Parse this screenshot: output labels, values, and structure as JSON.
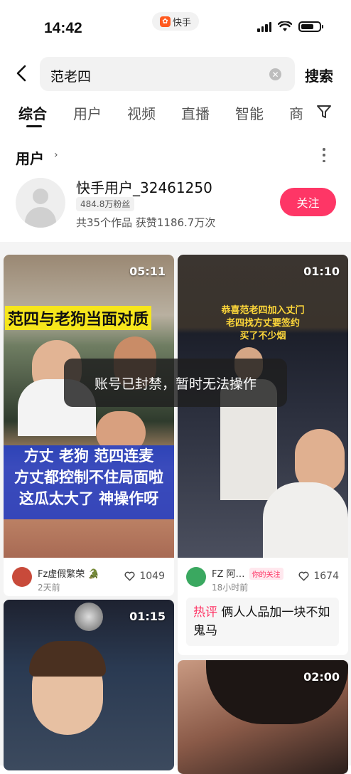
{
  "status_bar": {
    "time": "14:42",
    "app_pill": "快手"
  },
  "search": {
    "query": "范老四",
    "button": "搜索"
  },
  "tabs": [
    {
      "label": "综合",
      "active": true
    },
    {
      "label": "用户",
      "active": false
    },
    {
      "label": "视频",
      "active": false
    },
    {
      "label": "直播",
      "active": false
    },
    {
      "label": "智能",
      "active": false
    },
    {
      "label": "商",
      "active": false
    }
  ],
  "user_section": {
    "title": "用户",
    "user": {
      "name": "快手用户_32461250",
      "fans": "484.8万粉丝",
      "stats": "共35个作品 获赞1186.7万次",
      "follow_label": "关注"
    }
  },
  "videos": [
    {
      "duration": "05:11",
      "overlay_top": "范四与老狗当面对质",
      "overlay_lines": [
        "方丈 老狗 范四连麦",
        "方丈都控制不住局面啦",
        "这瓜太大了 神操作呀"
      ],
      "author": "Fz虚假繁荣",
      "time": "2天前",
      "likes": "1049"
    },
    {
      "duration": "01:10",
      "overlay_lines": [
        "恭喜范老四加入丈门",
        "老四找方丈要签约",
        "买了不少烟"
      ],
      "author": "FZ 阿…",
      "tag": "你的关注",
      "time": "18小时前",
      "likes": "1674",
      "comment_tag": "热评",
      "comment": "俩人人品加一块不如鬼马"
    },
    {
      "duration": "01:15"
    },
    {
      "duration": "02:00"
    }
  ],
  "toast": "账号已封禁，暂时无法操作",
  "colors": {
    "accent": "#fe3666",
    "yellow_banner": "#f6e61c",
    "blue_banner": "#1e3cc8"
  }
}
